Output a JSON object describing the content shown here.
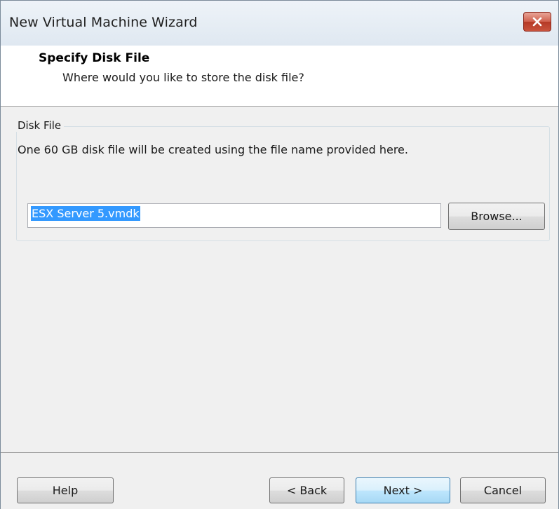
{
  "window": {
    "title": "New Virtual Machine Wizard",
    "close_icon": "close-icon"
  },
  "header": {
    "title": "Specify Disk File",
    "subtitle": "Where would you like to store the disk file?"
  },
  "disk_file": {
    "group_label": "Disk File",
    "description": "One 60 GB disk file will be created using the file name provided here.",
    "file_name_value": "ESX Server 5.vmdk",
    "browse_label": "Browse..."
  },
  "footer": {
    "help_label": "Help",
    "back_label": "< Back",
    "next_label": "Next >",
    "cancel_label": "Cancel"
  },
  "colors": {
    "selection": "#3399ff",
    "close_button": "#c9533d",
    "default_button_border": "#3c7fb1"
  }
}
